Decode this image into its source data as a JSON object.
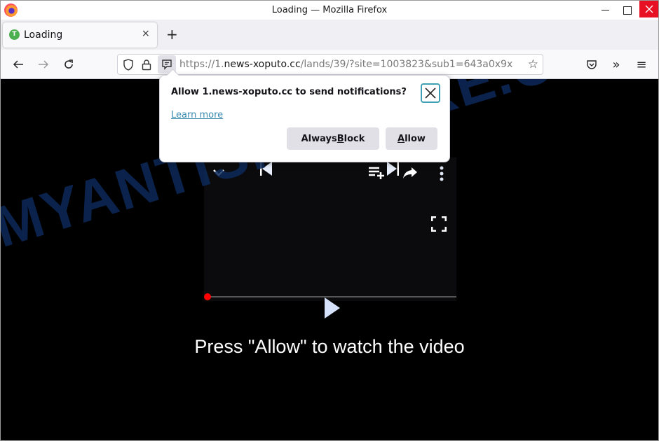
{
  "window": {
    "title": "Loading — Mozilla Firefox",
    "controls": {
      "minimize": "minimize",
      "maximize": "maximize",
      "close": "close"
    }
  },
  "tabs": [
    {
      "label": "Loading",
      "favicon_letter": "T",
      "active": true
    }
  ],
  "tabstrip": {
    "new_tab": "+",
    "close_glyph": "×"
  },
  "navbar": {
    "back": "←",
    "forward": "→",
    "reload": "↻",
    "url": {
      "scheme": "https://",
      "subdomain": "1.",
      "host": "news-xoputo.cc",
      "path": "/lands/39/?site=1003823&sub1=643a0x9x"
    },
    "bookmark_star": "☆",
    "overflow": "»",
    "menu": "≡"
  },
  "notification_popup": {
    "message": "Allow 1.news-xoputo.cc to send notifications?",
    "learn_more": "Learn more",
    "block_button": {
      "pre": "Always ",
      "accesskey": "B",
      "post": "lock"
    },
    "allow_button": {
      "pre": "",
      "accesskey": "A",
      "post": "llow"
    }
  },
  "page": {
    "cta_text": "Press \"Allow\" to watch the video",
    "watermark": "MYANTISPYWARE.COM",
    "player": {
      "progress": 0
    }
  },
  "colors": {
    "close_red": "#e81123",
    "progress_dot": "#ff0000",
    "focus_ring": "#3fa0b5",
    "link": "#3a8ab0",
    "watermark": "#0d2a5a"
  }
}
